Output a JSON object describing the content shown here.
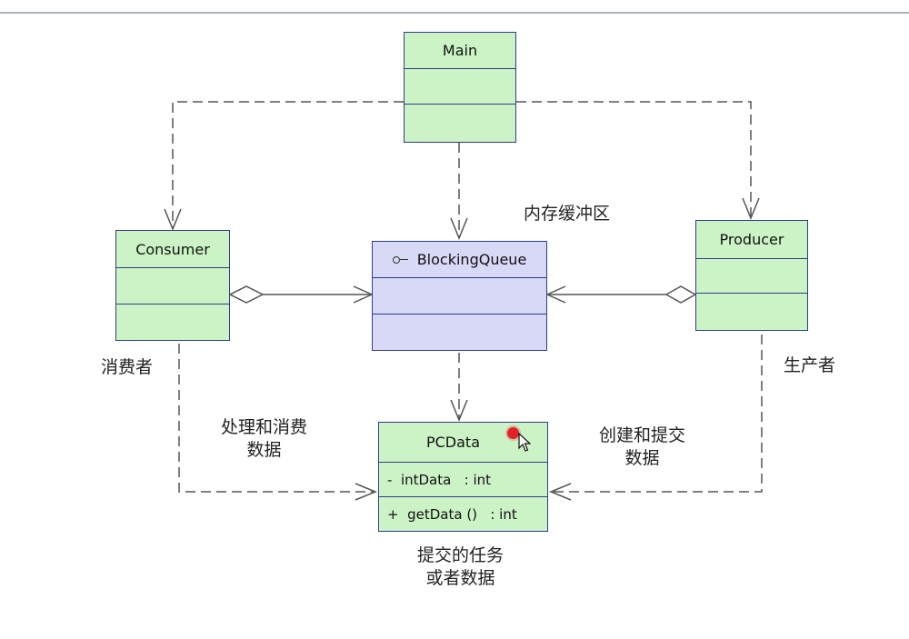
{
  "classes": {
    "main": {
      "name": "Main"
    },
    "consumer": {
      "name": "Consumer"
    },
    "producer": {
      "name": "Producer"
    },
    "blocking_queue": {
      "name": "BlockingQueue"
    },
    "pcdata": {
      "name": "PCData",
      "attribute": "-  intData   : int",
      "operation": "+  getData ()   : int"
    }
  },
  "annotations": {
    "buffer": "内存缓冲区",
    "consumer_role": "消费者",
    "producer_role": "生产者",
    "consume": [
      "处理和消费",
      "数据"
    ],
    "produce": [
      "创建和提交",
      "数据"
    ],
    "task": [
      "提交的任务",
      "或者数据"
    ]
  },
  "colors": {
    "class_fill": "#ccf3c6",
    "queue_fill": "#d8d8f7",
    "border": "#2f3d86",
    "line": "#555555",
    "cursor": "#e0232a"
  },
  "icons": [
    "interface-icon",
    "cursor-icon"
  ]
}
